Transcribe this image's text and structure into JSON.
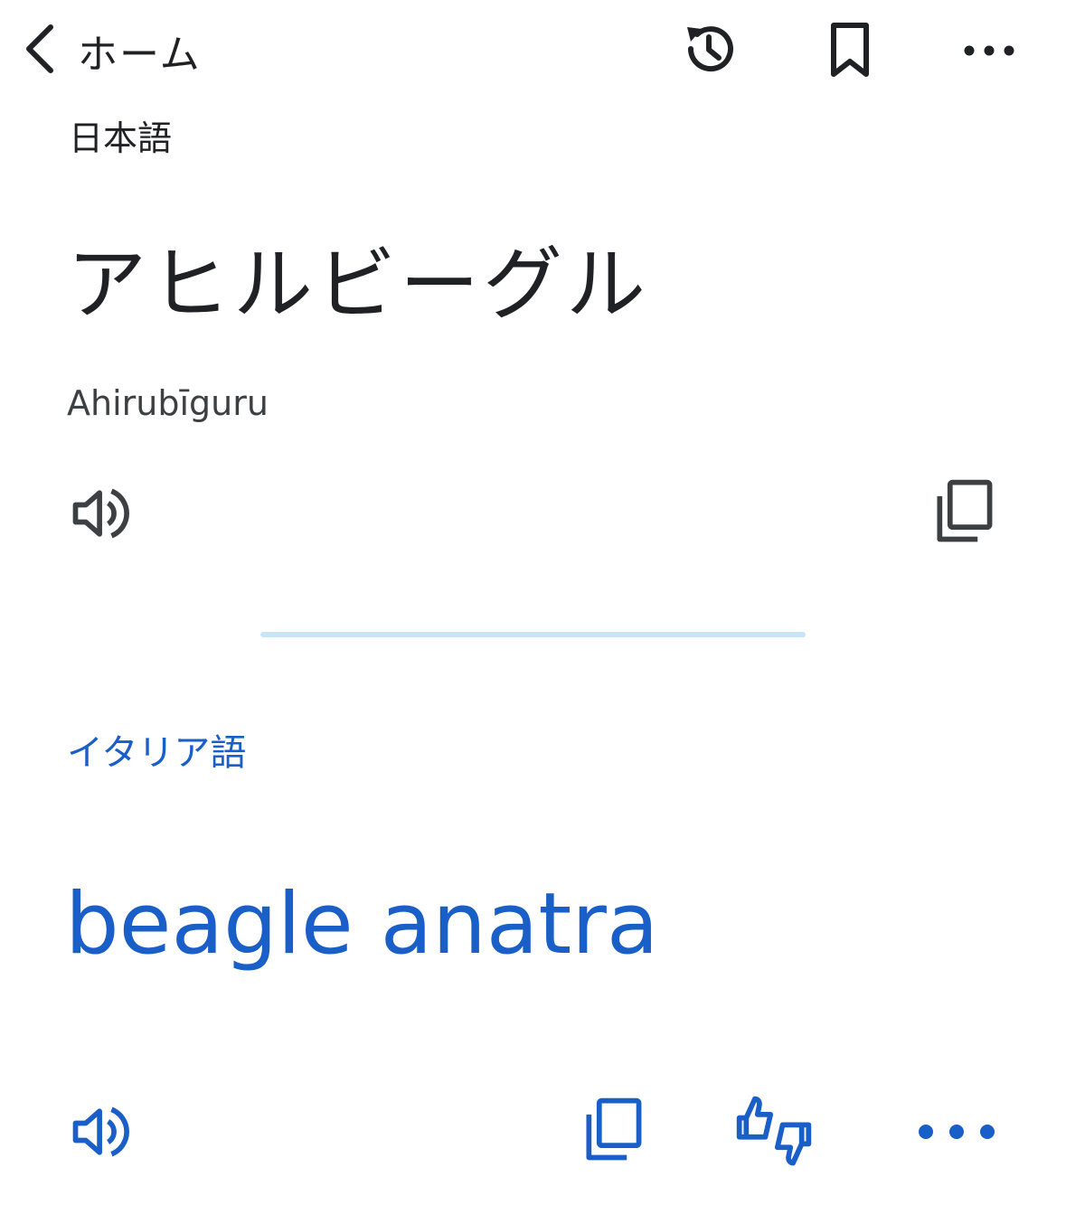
{
  "header": {
    "back_label": "ホーム",
    "icons": [
      "chevron-left-icon",
      "history-icon",
      "bookmark-icon",
      "more-horiz-icon"
    ]
  },
  "source": {
    "language": "日本語",
    "text": "アヒルビーグル",
    "transliteration": "Ahirubīguru"
  },
  "target": {
    "language": "イタリア語",
    "text": "beagle anatra"
  },
  "colors": {
    "text_primary": "#202124",
    "accent_blue": "#1a5fc7",
    "divider": "#c7e5f9"
  }
}
